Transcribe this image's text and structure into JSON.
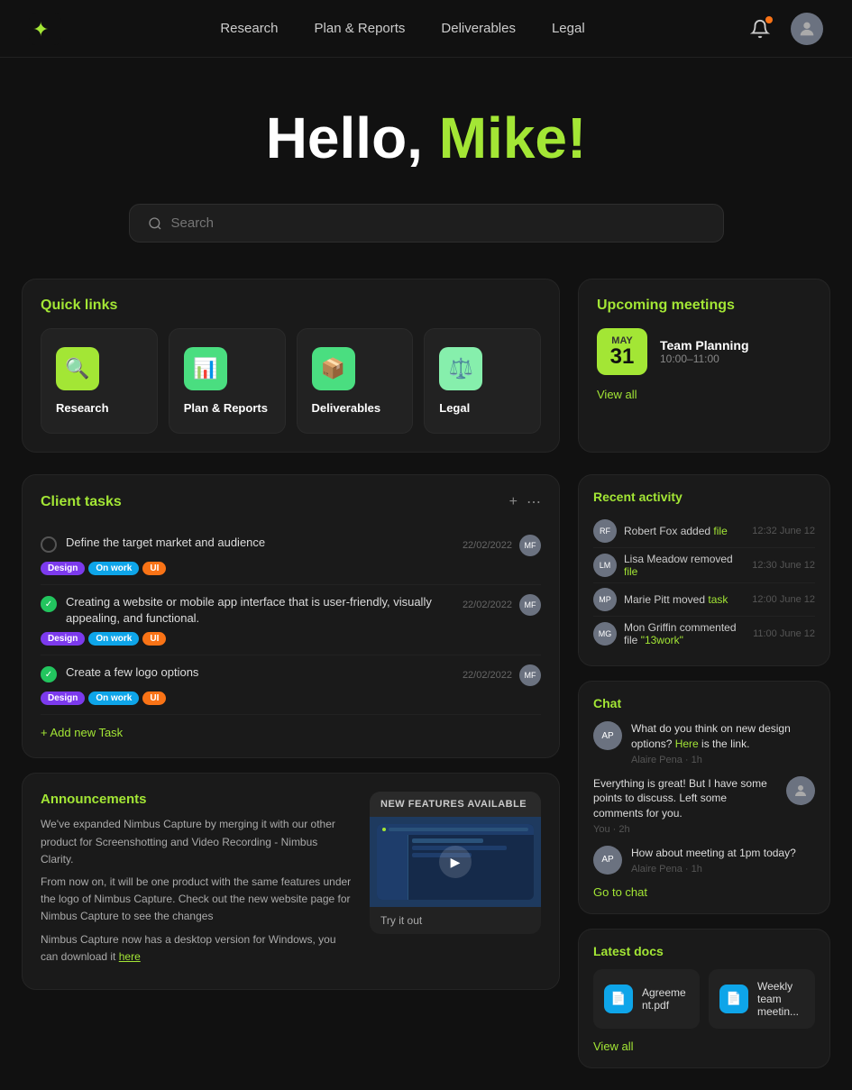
{
  "app": {
    "logo": "✦"
  },
  "nav": {
    "links": [
      {
        "label": "Research",
        "id": "research"
      },
      {
        "label": "Plan & Reports",
        "id": "plan-reports"
      },
      {
        "label": "Deliverables",
        "id": "deliverables"
      },
      {
        "label": "Legal",
        "id": "legal"
      }
    ]
  },
  "hero": {
    "greeting": "Hello, ",
    "name": "Mike!"
  },
  "search": {
    "placeholder": "Search"
  },
  "quick_links": {
    "title": "Quick links",
    "items": [
      {
        "label": "Research",
        "icon": "🔍",
        "icon_class": "icon-research"
      },
      {
        "label": "Plan & Reports",
        "icon": "📊",
        "icon_class": "icon-plan"
      },
      {
        "label": "Deliverables",
        "icon": "📦",
        "icon_class": "icon-deliverables"
      },
      {
        "label": "Legal",
        "icon": "⚖️",
        "icon_class": "icon-legal"
      }
    ]
  },
  "upcoming_meetings": {
    "title": "Upcoming meetings",
    "meeting": {
      "month": "May",
      "day": "31",
      "name": "Team Planning",
      "time": "10:00–11:00"
    },
    "view_all": "View all"
  },
  "client_tasks": {
    "title": "Client tasks",
    "tasks": [
      {
        "text": "Define the target market and audience",
        "done": false,
        "date": "22/02/2022",
        "tags": [
          "Design",
          "On work",
          "UI"
        ]
      },
      {
        "text": "Creating a website or mobile app interface that is user-friendly, visually appealing, and functional.",
        "done": true,
        "date": "22/02/2022",
        "tags": [
          "Design",
          "On work",
          "UI"
        ]
      },
      {
        "text": "Create a few logo options",
        "done": true,
        "date": "22/02/2022",
        "tags": [
          "Design",
          "On work",
          "UI"
        ]
      }
    ],
    "add_task": "+ Add new Task"
  },
  "recent_activity": {
    "title": "Recent activity",
    "items": [
      {
        "user": "Robert Fox",
        "action": "added",
        "item": "file",
        "time": "12:32 June 12"
      },
      {
        "user": "Lisa Meadow",
        "action": "removed",
        "item": "file",
        "time": "12:30 June 12"
      },
      {
        "user": "Marie Pitt",
        "action": "moved",
        "item": "task",
        "time": "12:00 June 12"
      },
      {
        "user": "Mon Griffin",
        "action": "commented file",
        "item": "\"13work\"",
        "time": "11:00 June 12"
      }
    ]
  },
  "chat": {
    "title": "Chat",
    "messages": [
      {
        "from": "Alaire Pena",
        "text": "What do you think on new design options? Here is the link.",
        "link_text": "Here",
        "side": "left",
        "time": "Alaire Pena · 1h"
      },
      {
        "from": "You",
        "text": "Everything is great! But I have some points to discuss. Left some comments for you.",
        "side": "right",
        "time": "You · 2h"
      },
      {
        "from": "Alaire Pena",
        "text": "How about meeting at 1pm today?",
        "side": "left",
        "time": "Alaire Pena · 1h"
      }
    ],
    "go_to_chat": "Go to chat"
  },
  "latest_docs": {
    "title": "Latest docs",
    "items": [
      {
        "name": "Agreement.pdf"
      },
      {
        "name": "Weekly team meetin..."
      }
    ],
    "view_all": "View all"
  },
  "announcements": {
    "title": "Announcements",
    "paragraphs": [
      "We've expanded Nimbus Capture by merging it with our other product for Screenshotting and Video Recording - Nimbus Clarity.",
      "From now on, it will be one product with the same features under the logo of Nimbus Capture. Check out the new website page for Nimbus Capture to see the changes",
      "Nimbus Capture now has a desktop version for Windows, you can download it here"
    ],
    "new_features": {
      "label": "NEW FEATURES AVAILABLE",
      "try_it": "Try it out"
    }
  }
}
